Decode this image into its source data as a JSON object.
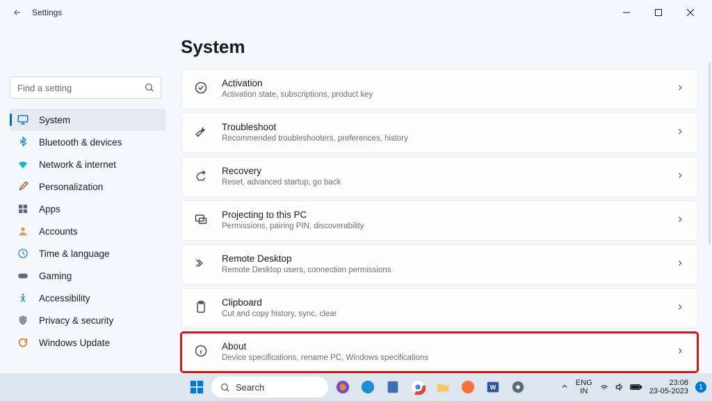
{
  "titlebar": {
    "app_title": "Settings"
  },
  "search": {
    "placeholder": "Find a setting"
  },
  "nav": [
    {
      "label": "System",
      "icon": "system",
      "active": true
    },
    {
      "label": "Bluetooth & devices",
      "icon": "bluetooth"
    },
    {
      "label": "Network & internet",
      "icon": "wifi"
    },
    {
      "label": "Personalization",
      "icon": "brush"
    },
    {
      "label": "Apps",
      "icon": "apps"
    },
    {
      "label": "Accounts",
      "icon": "person"
    },
    {
      "label": "Time & language",
      "icon": "clock"
    },
    {
      "label": "Gaming",
      "icon": "gamepad"
    },
    {
      "label": "Accessibility",
      "icon": "accessibility"
    },
    {
      "label": "Privacy & security",
      "icon": "shield"
    },
    {
      "label": "Windows Update",
      "icon": "update"
    }
  ],
  "page": {
    "title": "System"
  },
  "cards": [
    {
      "title": "Activation",
      "sub": "Activation state, subscriptions, product key",
      "icon": "check-circle"
    },
    {
      "title": "Troubleshoot",
      "sub": "Recommended troubleshooters, preferences, history",
      "icon": "wrench"
    },
    {
      "title": "Recovery",
      "sub": "Reset, advanced startup, go back",
      "icon": "recovery"
    },
    {
      "title": "Projecting to this PC",
      "sub": "Permissions, pairing PIN, discoverability",
      "icon": "project"
    },
    {
      "title": "Remote Desktop",
      "sub": "Remote Desktop users, connection permissions",
      "icon": "remote"
    },
    {
      "title": "Clipboard",
      "sub": "Cut and copy history, sync, clear",
      "icon": "clipboard"
    },
    {
      "title": "About",
      "sub": "Device specifications, rename PC, Windows specifications",
      "icon": "info",
      "highlight": true
    }
  ],
  "taskbar": {
    "search_label": "Search",
    "lang": {
      "top": "ENG",
      "bottom": "IN"
    },
    "time": {
      "top": "23:08",
      "bottom": "23-05-2023"
    },
    "badge": "1"
  }
}
